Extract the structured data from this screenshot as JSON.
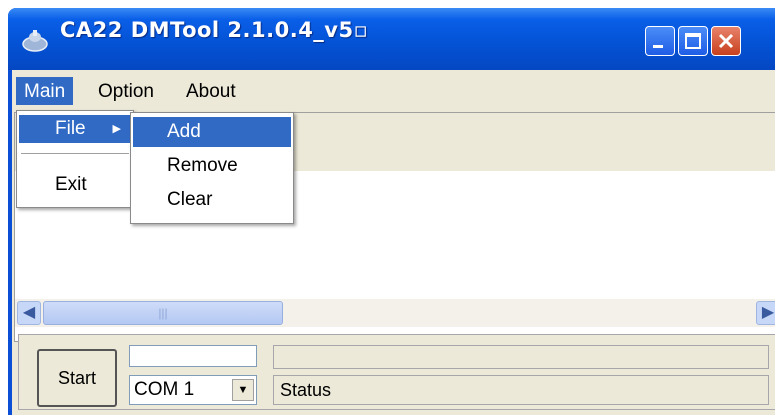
{
  "window": {
    "title": "CA22 DMTool 2.1.0.4_v5▫"
  },
  "menubar": {
    "items": [
      "Main",
      "Option",
      "About"
    ]
  },
  "main_menu": {
    "file_label": "File",
    "exit_label": "Exit"
  },
  "file_submenu": {
    "items": [
      "Add",
      "Remove",
      "Clear"
    ]
  },
  "controls": {
    "start_label": "Start",
    "com_port": "COM 1",
    "status": "Status"
  },
  "colors": {
    "title_bar": "#0453d6",
    "selection": "#316ac5",
    "close_button": "#c7401d",
    "window_face": "#ece9d8"
  },
  "icons": {
    "app": "app-icon",
    "minimize": "minimize-icon",
    "maximize": "maximize-icon",
    "close": "close-icon",
    "submenu_arrow": "chevron-right-icon",
    "scroll_left": "scroll-left-arrow-icon",
    "scroll_right": "scroll-right-arrow-icon",
    "dropdown_arrow": "chevron-down-icon"
  }
}
